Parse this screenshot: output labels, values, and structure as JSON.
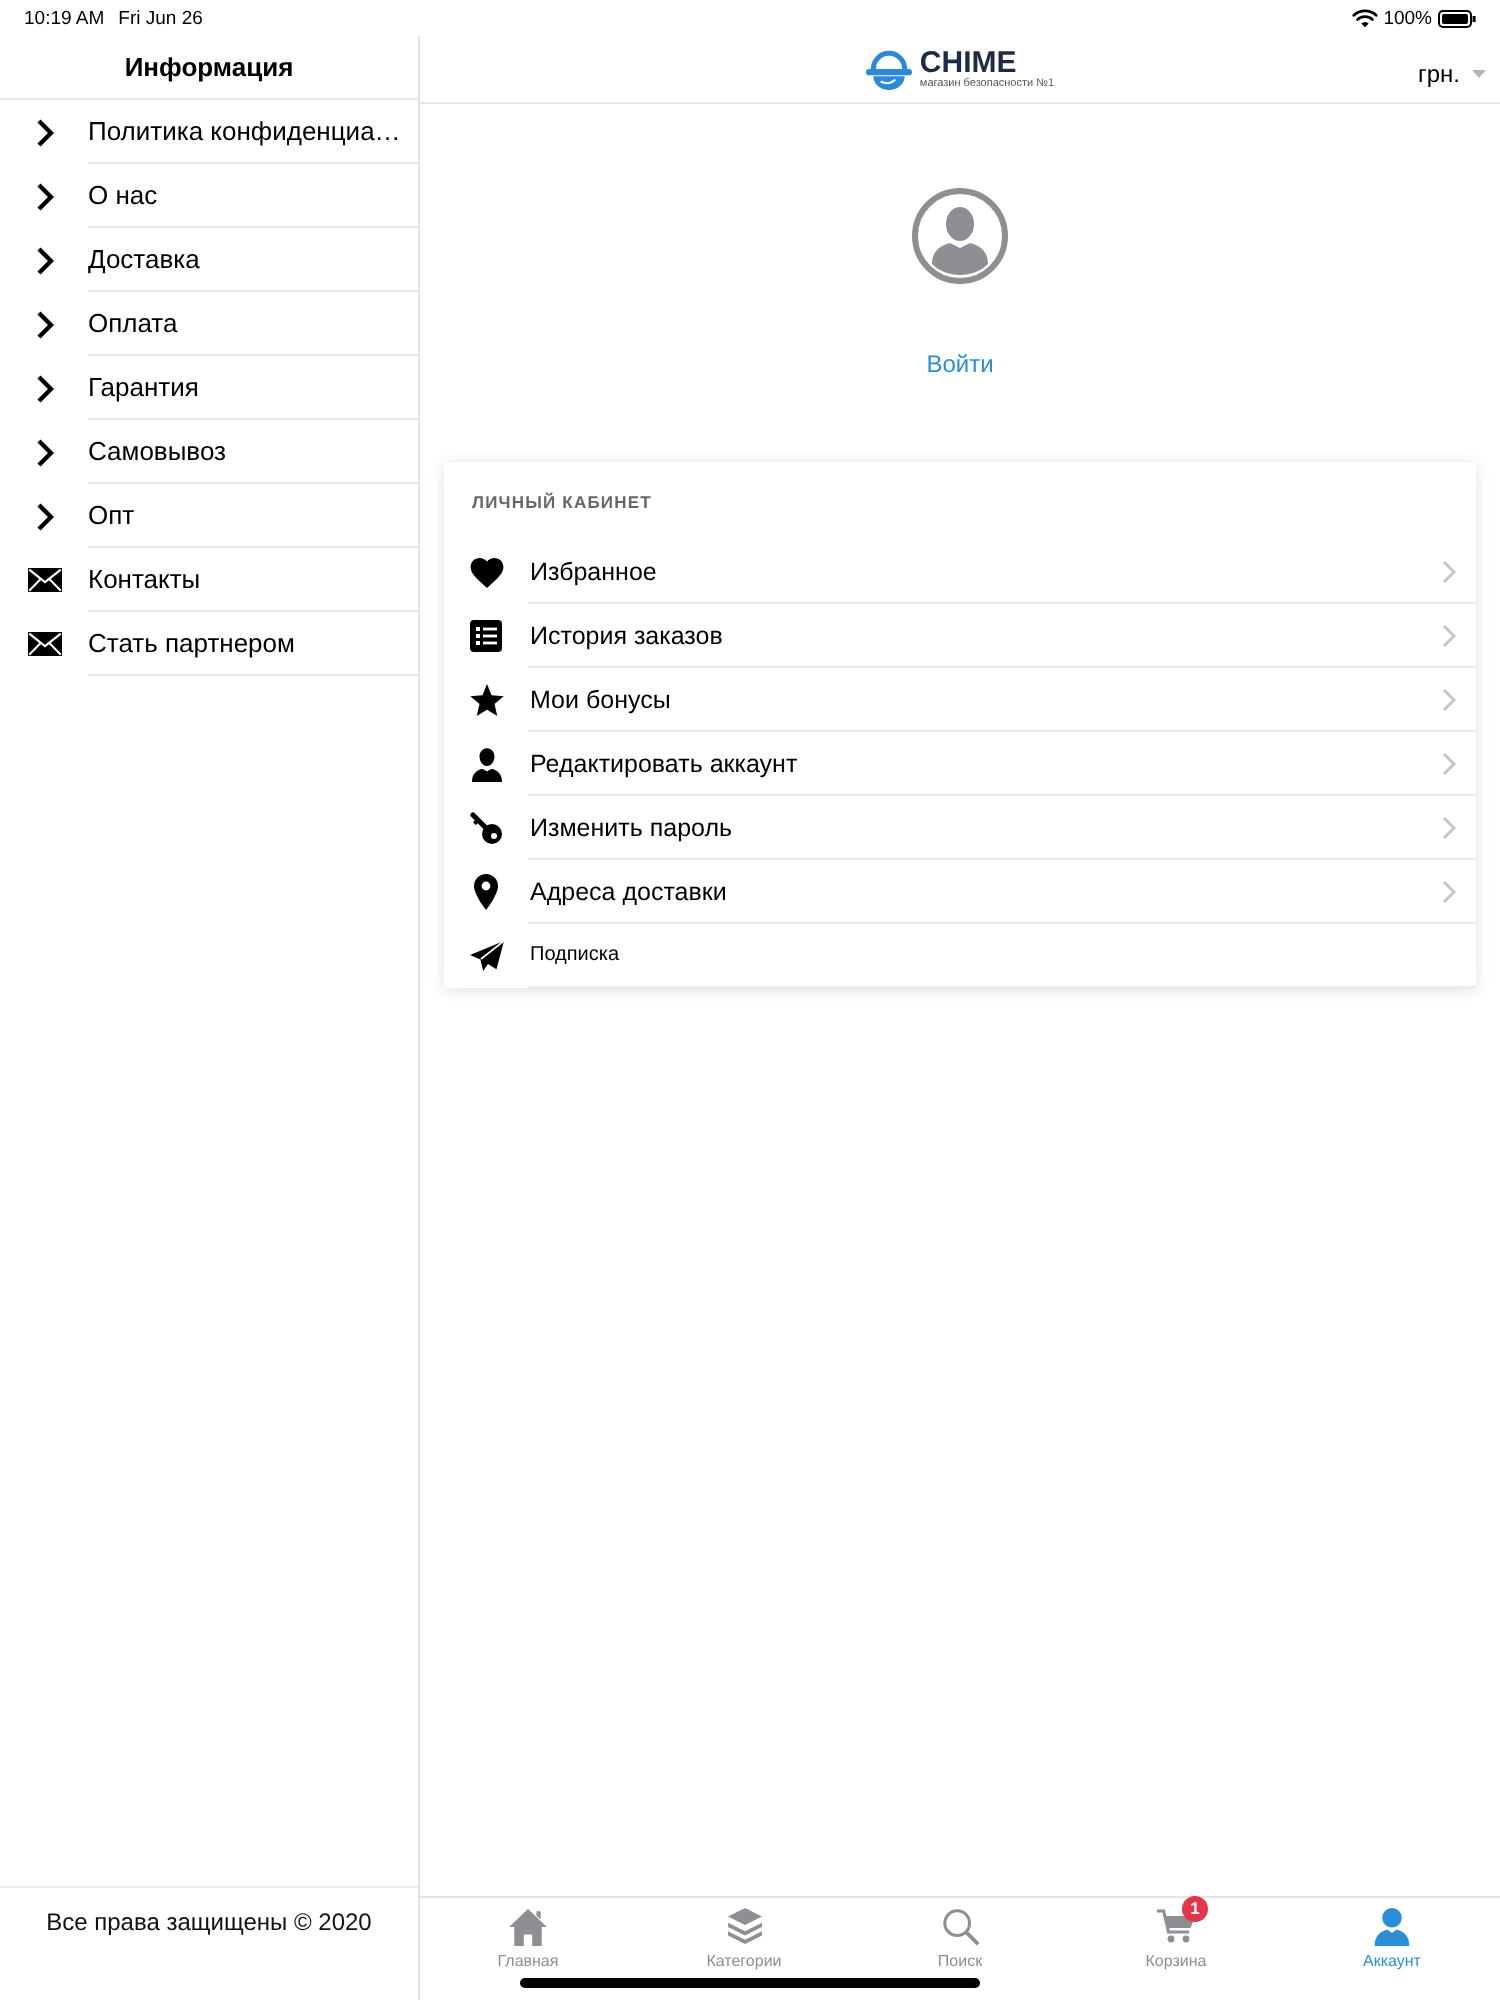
{
  "status_bar": {
    "time": "10:19 AM",
    "date": "Fri Jun 26",
    "battery": "100%"
  },
  "sidebar": {
    "title": "Информация",
    "items": [
      {
        "kind": "page",
        "label": "Политика конфиденциа…"
      },
      {
        "kind": "page",
        "label": "О нас"
      },
      {
        "kind": "page",
        "label": "Доставка"
      },
      {
        "kind": "page",
        "label": "Оплата"
      },
      {
        "kind": "page",
        "label": "Гарантия"
      },
      {
        "kind": "page",
        "label": "Самовывоз"
      },
      {
        "kind": "page",
        "label": "Опт"
      },
      {
        "kind": "message",
        "label": "Контакты"
      },
      {
        "kind": "message",
        "label": "Стать партнером"
      }
    ],
    "footer": "Все права защищены © 2020"
  },
  "header": {
    "logo": {
      "name": "CHIME",
      "tagline": "магазин безопасности №1"
    },
    "currency": "грн."
  },
  "profile": {
    "login": "Войти"
  },
  "account": {
    "title": "ЛИЧНЫЙ КАБИНЕТ",
    "items": [
      {
        "kind": "link",
        "label": "Избранное"
      },
      {
        "kind": "link",
        "label": "История заказов"
      },
      {
        "kind": "link",
        "label": "Мои бонусы"
      },
      {
        "kind": "link",
        "label": "Редактировать аккаунт"
      },
      {
        "kind": "link",
        "label": "Изменить пароль"
      },
      {
        "kind": "link",
        "label": "Адреса доставки"
      },
      {
        "kind": "plain",
        "label": "Подписка"
      }
    ]
  },
  "tab_bar": {
    "tabs": [
      {
        "label": "Главная",
        "selected": false
      },
      {
        "label": "Категории",
        "selected": false
      },
      {
        "label": "Поиск",
        "selected": false
      },
      {
        "label": "Корзина",
        "badge": "1",
        "selected": false
      },
      {
        "label": "Аккаунт",
        "selected": true
      }
    ]
  }
}
